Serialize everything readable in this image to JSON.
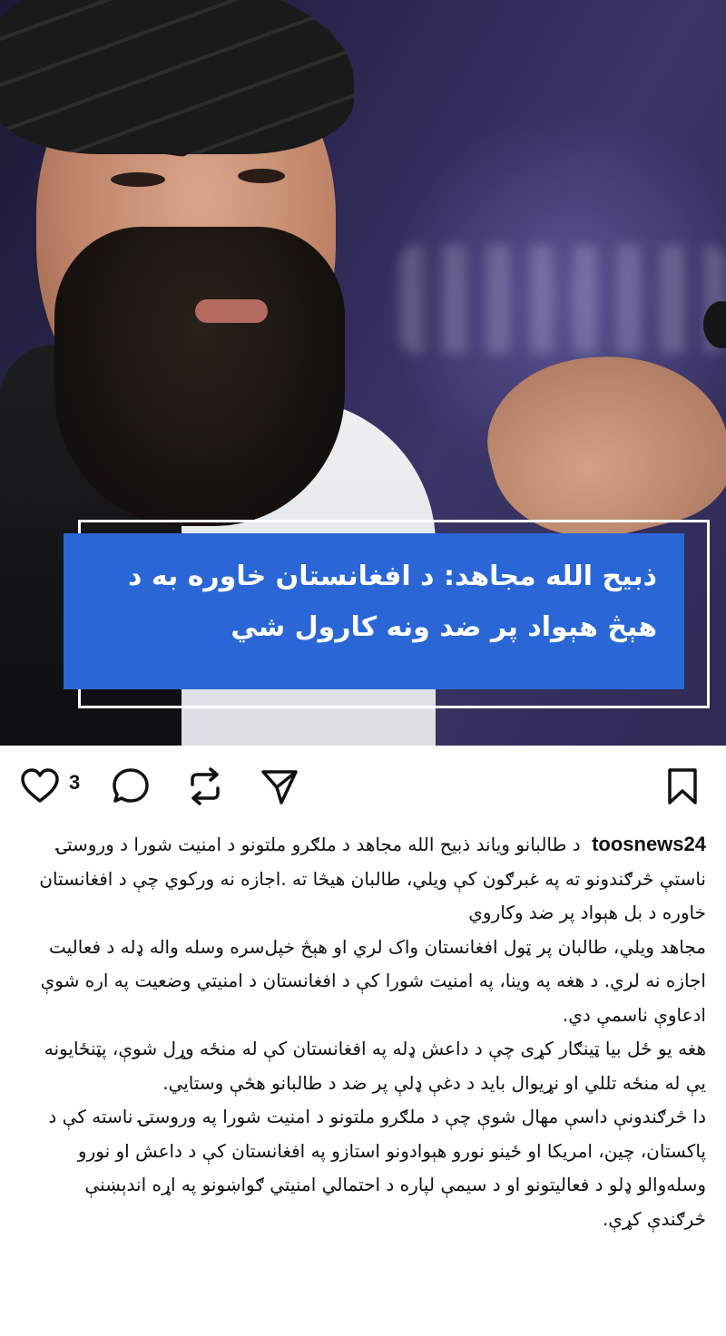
{
  "image": {
    "overlay_title": "ذبیح الله مجاهد: د افغانستان خاوره به د هېڅ هېواد پر ضد ونه کارول شي"
  },
  "actions": {
    "like_count": "3",
    "icons": [
      "heart-icon",
      "comment-icon",
      "repost-icon",
      "share-icon",
      "bookmark-icon"
    ]
  },
  "caption": {
    "username": "toosnews24",
    "intro": "د طالبانو وياند ذبیح الله مجاهد د ملګرو ملتونو د امنیت شورا د وروستۍ ناستې څرګندونو ته په غبرګون کې ویلي، طالبان هیڅا ته .اجازه نه ورکوي چې د افغانستان خاوره د بل هېواد پر ضد وکاروي",
    "paragraphs": [
      "مجاهد ویلي، طالبان پر ټول افغانستان واک لري او هېڅ خپل‌سره وسله واله ډله د فعالیت اجازه نه لري. د هغه په وینا، په امنیت شورا کې د افغانستان د امنیتي وضعیت په اره شوې ادعاوې ناسمې دي.",
      "هغه یو ځل بیا ټینګار کړی چې د داعش ډله په افغانستان کې له منځه وړل شوې، پټنځایونه یې له منځه تللي او نړیوال باید د دغې ډلې پر ضد د طالبانو هڅې وستایي.",
      "دا څرګندونې داسې مهال شوې چې د ملګرو ملتونو د امنیت شورا په وروستۍ ناسته کې د پاکستان، چین، امریکا او ځینو نورو هېوادونو استازو په افغانستان کې د داعش او نورو وسله‌والو ډلو د فعالیتونو او د سیمې لپاره د احتمالي امنیتي ګواښونو په اړه اندېښنې څرګندې کړې."
    ]
  },
  "colors": {
    "overlay_blue": "#2a66d6",
    "text": "#111111",
    "background": "#ffffff"
  }
}
